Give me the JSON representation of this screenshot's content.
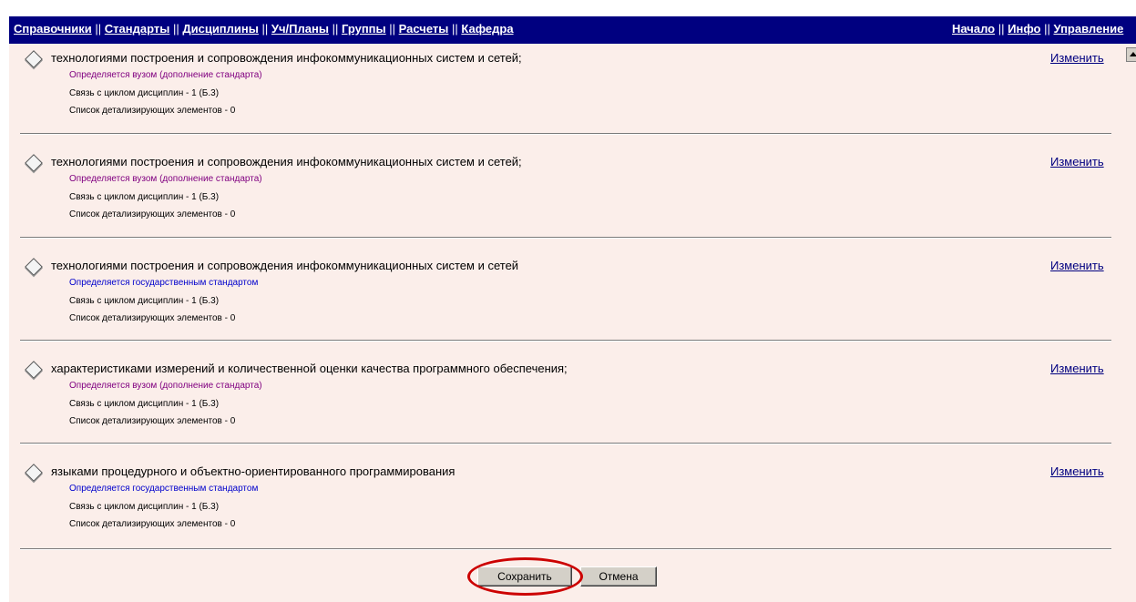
{
  "nav": {
    "left": [
      "Справочники",
      "Стандарты",
      "Дисциплины",
      "Уч/Планы",
      "Группы",
      "Расчеты",
      "Кафедра"
    ],
    "right": [
      "Начало",
      "Инфо",
      "Управление"
    ],
    "separator": "||"
  },
  "items": [
    {
      "title": "технологиями построения и сопровождения инфокоммуникационных систем и сетей;",
      "source": "Определяется вузом (дополнение стандарта)",
      "source_type": "vuz",
      "cycle": "Связь с циклом дисциплин - 1 (Б.3)",
      "details": "Список детализирующих элементов - 0",
      "edit_label": "Изменить"
    },
    {
      "title": "технологиями построения и сопровождения инфокоммуникационных систем и сетей;",
      "source": "Определяется вузом (дополнение стандарта)",
      "source_type": "vuz",
      "cycle": "Связь с циклом дисциплин - 1 (Б.3)",
      "details": "Список детализирующих элементов - 0",
      "edit_label": "Изменить"
    },
    {
      "title": "технологиями построения и сопровождения инфокоммуникационных систем и сетей",
      "source": "Определяется государственным стандартом",
      "source_type": "gos",
      "cycle": "Связь с циклом дисциплин - 1 (Б.3)",
      "details": "Список детализирующих элементов - 0",
      "edit_label": "Изменить"
    },
    {
      "title": "характеристиками измерений и количественной оценки качества программного обеспечения;",
      "source": "Определяется вузом (дополнение стандарта)",
      "source_type": "vuz",
      "cycle": "Связь с циклом дисциплин - 1 (Б.3)",
      "details": "Список детализирующих элементов - 0",
      "edit_label": "Изменить"
    },
    {
      "title": "языками процедурного и объектно-ориентированного программирования",
      "source": "Определяется государственным стандартом",
      "source_type": "gos",
      "cycle": "Связь с циклом дисциплин - 1 (Б.3)",
      "details": "Список детализирующих элементов - 0",
      "edit_label": "Изменить"
    }
  ],
  "buttons": {
    "save": "Сохранить",
    "cancel": "Отмена"
  },
  "colors": {
    "nav_bg": "#000080",
    "content_bg": "#fbeeea",
    "source_vuz": "#800080",
    "source_gos": "#0000cc",
    "highlight": "#cc0000"
  }
}
